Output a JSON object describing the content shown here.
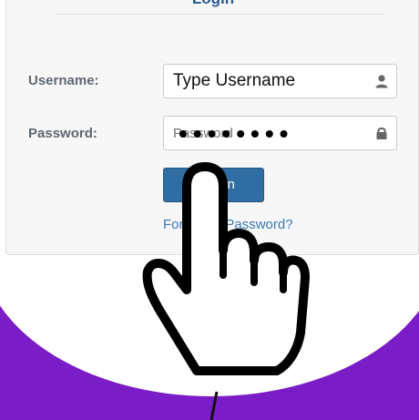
{
  "login": {
    "title": "Login",
    "username_label": "Username:",
    "username_value": "Type Username",
    "password_label": "Password:",
    "password_placeholder": "Password",
    "password_mask": "••••••••",
    "signin_label": "Sign In",
    "forgot_label": "Forgotten Password?"
  },
  "icons": {
    "username": "user-icon",
    "password": "lock-icon",
    "pointer": "pointing-hand-icon"
  },
  "colors": {
    "purple": "#7b1dc6",
    "title_blue": "#2a5b8f",
    "button_blue": "#2f6da3",
    "link_blue": "#3a79b5",
    "panel_gray": "#f7f7f7"
  }
}
